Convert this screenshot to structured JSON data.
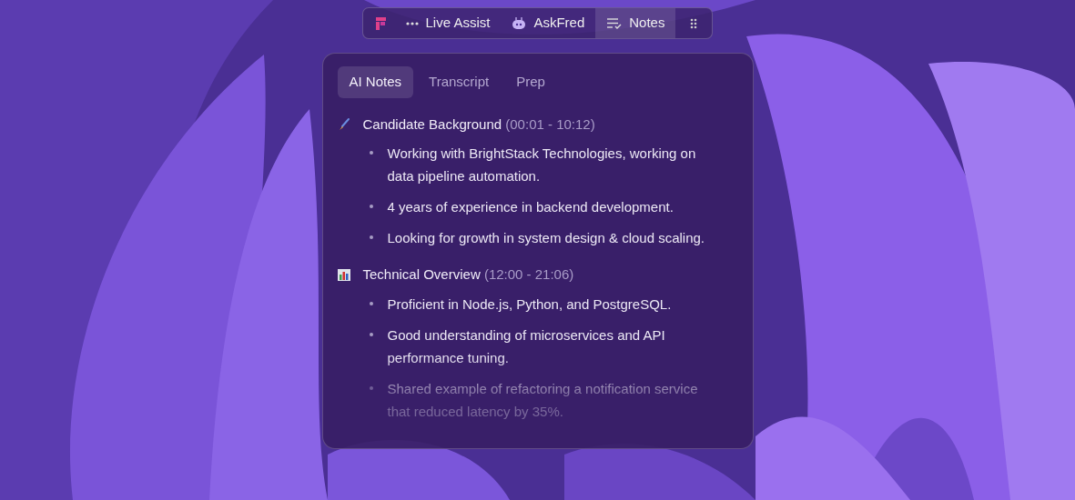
{
  "toolbar": {
    "items": [
      {
        "label": "Live Assist",
        "kind": "dots",
        "selected": false
      },
      {
        "label": "AskFred",
        "kind": "robot",
        "selected": false
      },
      {
        "label": "Notes",
        "kind": "notes",
        "selected": true
      }
    ]
  },
  "tabs": [
    {
      "label": "AI Notes",
      "selected": true
    },
    {
      "label": "Transcript",
      "selected": false
    },
    {
      "label": "Prep",
      "selected": false
    }
  ],
  "sections": [
    {
      "kind": "brush",
      "title": "Candidate Background",
      "time": "(00:01 - 10:12)",
      "bullets": [
        "Working with BrightStack Technologies, working on data pipeline automation.",
        "4 years of experience in backend development.",
        "Looking for growth in system design & cloud scaling."
      ]
    },
    {
      "kind": "chart",
      "title": "Technical Overview",
      "time": "(12:00 - 21:06)",
      "bullets": [
        "Proficient in Node.js, Python, and PostgreSQL.",
        "Good understanding of microservices and API performance tuning.",
        "Shared example of refactoring a notification service that reduced latency by 35%."
      ]
    }
  ]
}
